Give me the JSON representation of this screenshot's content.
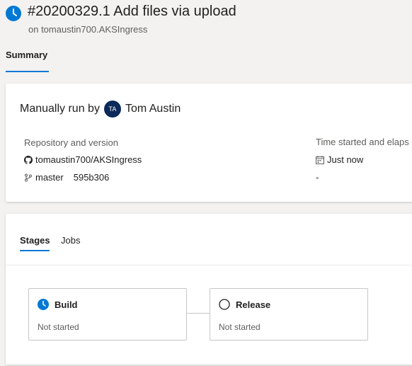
{
  "header": {
    "title": "#20200329.1 Add files via upload",
    "subtitle": "on tomaustin700.AKSIngress",
    "status_icon": "clock-icon",
    "accent_color": "#0078d4"
  },
  "tabs": [
    {
      "label": "Summary",
      "selected": true
    }
  ],
  "summary": {
    "run_by_text": "Manually run by",
    "avatar_initials": "TA",
    "user_name": "Tom Austin",
    "repo_label": "Repository and version",
    "repo_name": "tomaustin700/AKSIngress",
    "repo_icon": "github-icon",
    "branch_name": "master",
    "branch_icon": "branch-icon",
    "commit_id": "595b306",
    "time_label": "Time started and elaps",
    "time_value": "Just now",
    "time_icon": "calendar-icon",
    "elapsed_value": "-"
  },
  "stages_section": {
    "tabs": [
      {
        "label": "Stages",
        "selected": true
      },
      {
        "label": "Jobs",
        "selected": false
      }
    ],
    "stages": [
      {
        "name": "Build",
        "status": "Not started",
        "icon": "clock-icon"
      },
      {
        "name": "Release",
        "status": "Not started",
        "icon": "empty-circle-icon"
      }
    ]
  }
}
